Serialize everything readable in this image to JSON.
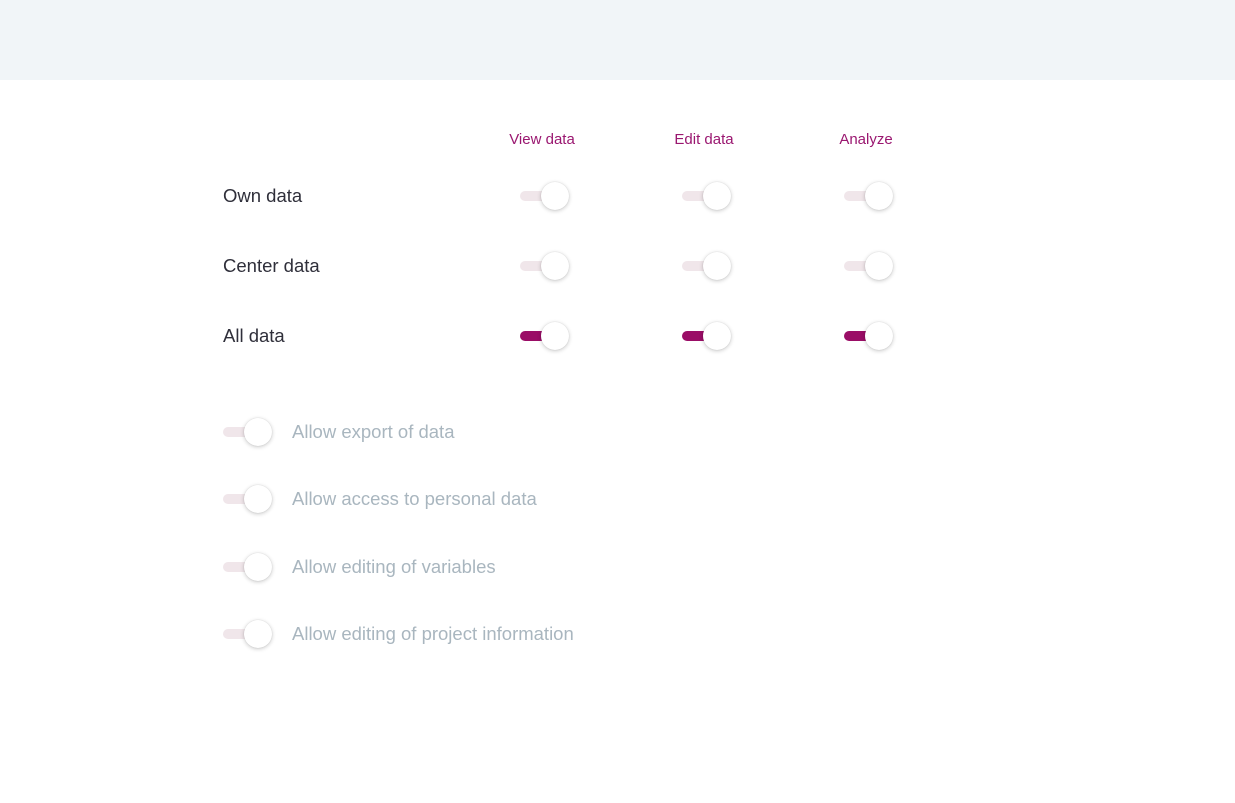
{
  "matrix": {
    "columns": [
      "View data",
      "Edit data",
      "Analyze"
    ],
    "rows": [
      {
        "label": "Own data",
        "values": [
          false,
          false,
          false
        ]
      },
      {
        "label": "Center data",
        "values": [
          false,
          false,
          false
        ]
      },
      {
        "label": "All data",
        "values": [
          true,
          true,
          true
        ]
      }
    ]
  },
  "options": [
    {
      "label": "Allow export of data",
      "enabled": false
    },
    {
      "label": "Allow access to personal data",
      "enabled": false
    },
    {
      "label": "Allow editing of variables",
      "enabled": false
    },
    {
      "label": "Allow editing of project information",
      "enabled": false
    }
  ],
  "colors": {
    "accent": "#9a0d66",
    "header_text": "#9a1770",
    "track_off": "#f0e6ea",
    "top_bar": "#f1f5f8",
    "option_text": "#a9b6bf"
  }
}
